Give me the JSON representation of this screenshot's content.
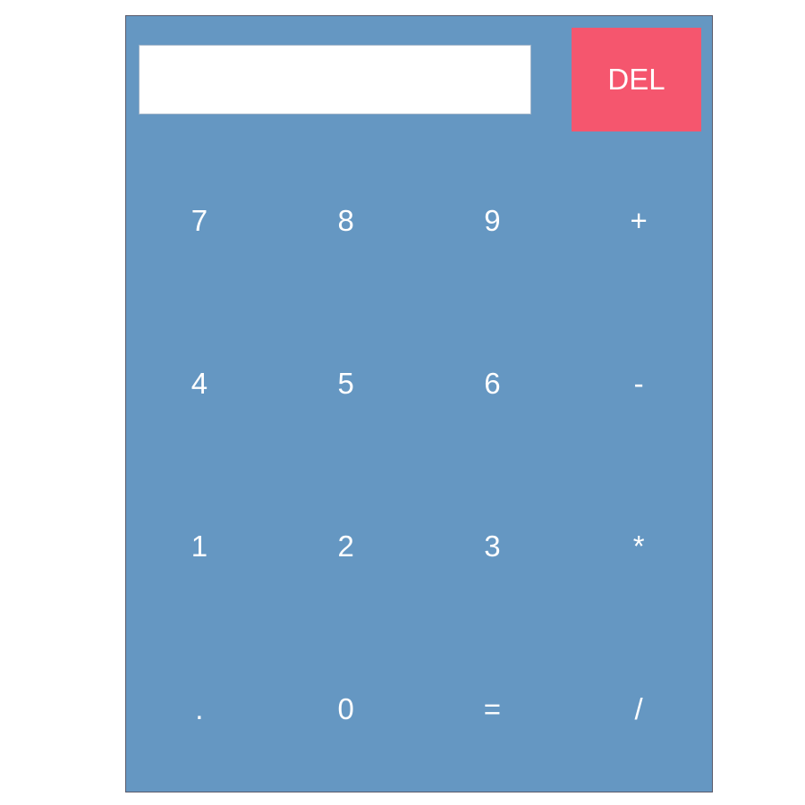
{
  "display": {
    "value": ""
  },
  "delete_button": {
    "label": "DEL"
  },
  "keypad": {
    "rows": [
      [
        {
          "label": "7",
          "name": "key-7"
        },
        {
          "label": "8",
          "name": "key-8"
        },
        {
          "label": "9",
          "name": "key-9"
        },
        {
          "label": "+",
          "name": "key-plus"
        }
      ],
      [
        {
          "label": "4",
          "name": "key-4"
        },
        {
          "label": "5",
          "name": "key-5"
        },
        {
          "label": "6",
          "name": "key-6"
        },
        {
          "label": "-",
          "name": "key-minus"
        }
      ],
      [
        {
          "label": "1",
          "name": "key-1"
        },
        {
          "label": "2",
          "name": "key-2"
        },
        {
          "label": "3",
          "name": "key-3"
        },
        {
          "label": "*",
          "name": "key-multiply"
        }
      ],
      [
        {
          "label": ".",
          "name": "key-decimal"
        },
        {
          "label": "0",
          "name": "key-0"
        },
        {
          "label": "=",
          "name": "key-equals"
        },
        {
          "label": "/",
          "name": "key-divide"
        }
      ]
    ]
  },
  "colors": {
    "body": "#6597c2",
    "delete": "#f5566e",
    "key_text": "#ffffff",
    "display": "#ffffff"
  }
}
